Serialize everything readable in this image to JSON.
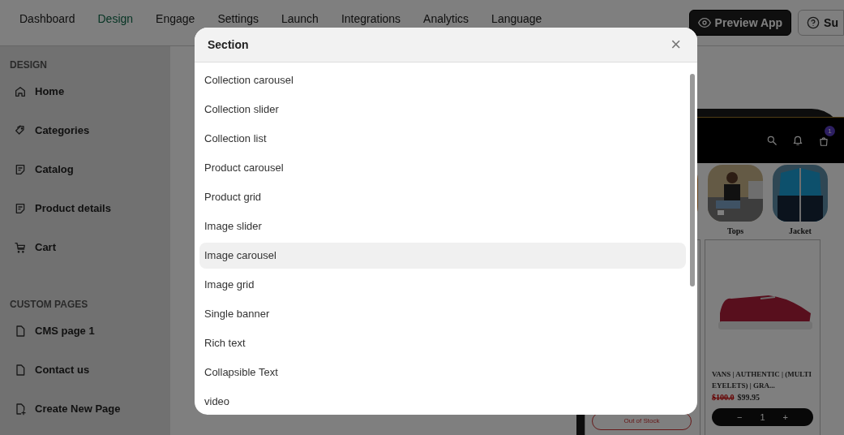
{
  "top_nav": {
    "tabs": [
      {
        "label": "Dashboard",
        "selected": false
      },
      {
        "label": "Design",
        "selected": true
      },
      {
        "label": "Engage",
        "selected": false
      },
      {
        "label": "Settings",
        "selected": false
      },
      {
        "label": "Launch",
        "selected": false
      },
      {
        "label": "Integrations",
        "selected": false
      },
      {
        "label": "Analytics",
        "selected": false
      },
      {
        "label": "Language",
        "selected": false
      }
    ],
    "buttons": [
      {
        "label": "Preview App",
        "kind": "dark"
      },
      {
        "label": "Su",
        "kind": "outline"
      }
    ]
  },
  "sidebar": {
    "sections": [
      {
        "title": "DESIGN",
        "items": [
          {
            "label": "Home"
          },
          {
            "label": "Categories"
          },
          {
            "label": "Catalog"
          },
          {
            "label": "Product details"
          },
          {
            "label": "Cart"
          }
        ]
      },
      {
        "title": "CUSTOM PAGES",
        "items": [
          {
            "label": "CMS page 1"
          },
          {
            "label": "Contact us"
          },
          {
            "label": "Create New Page"
          }
        ]
      }
    ]
  },
  "preview": {
    "cart_count": "1",
    "categories": [
      {
        "kind": "picture"
      },
      {
        "kind": "picture",
        "label": "Tops"
      },
      {
        "kind": "picture",
        "label": "Jacket"
      }
    ],
    "products": [
      {
        "stock_button": "Out of Stock"
      },
      {
        "title": "VANS | AUTHENTIC | (MULTI EYELETS) | GRA...",
        "old_price": "$100.0",
        "price": "$99.95",
        "minus": "−",
        "quantity": "1",
        "plus": "+"
      }
    ]
  },
  "modal": {
    "title": "Section",
    "close": "×",
    "items": [
      {
        "label": "Collection carousel",
        "selected": false
      },
      {
        "label": "Collection slider",
        "selected": false
      },
      {
        "label": "Collection list",
        "selected": false
      },
      {
        "label": "Product carousel",
        "selected": false
      },
      {
        "label": "Product grid",
        "selected": false
      },
      {
        "label": "Image slider",
        "selected": false
      },
      {
        "label": "Image carousel",
        "selected": true
      },
      {
        "label": "Image grid",
        "selected": false
      },
      {
        "label": "Single banner",
        "selected": false
      },
      {
        "label": "Rich text",
        "selected": false
      },
      {
        "label": "Collapsible Text",
        "selected": false
      },
      {
        "label": "video",
        "selected": false
      }
    ]
  }
}
